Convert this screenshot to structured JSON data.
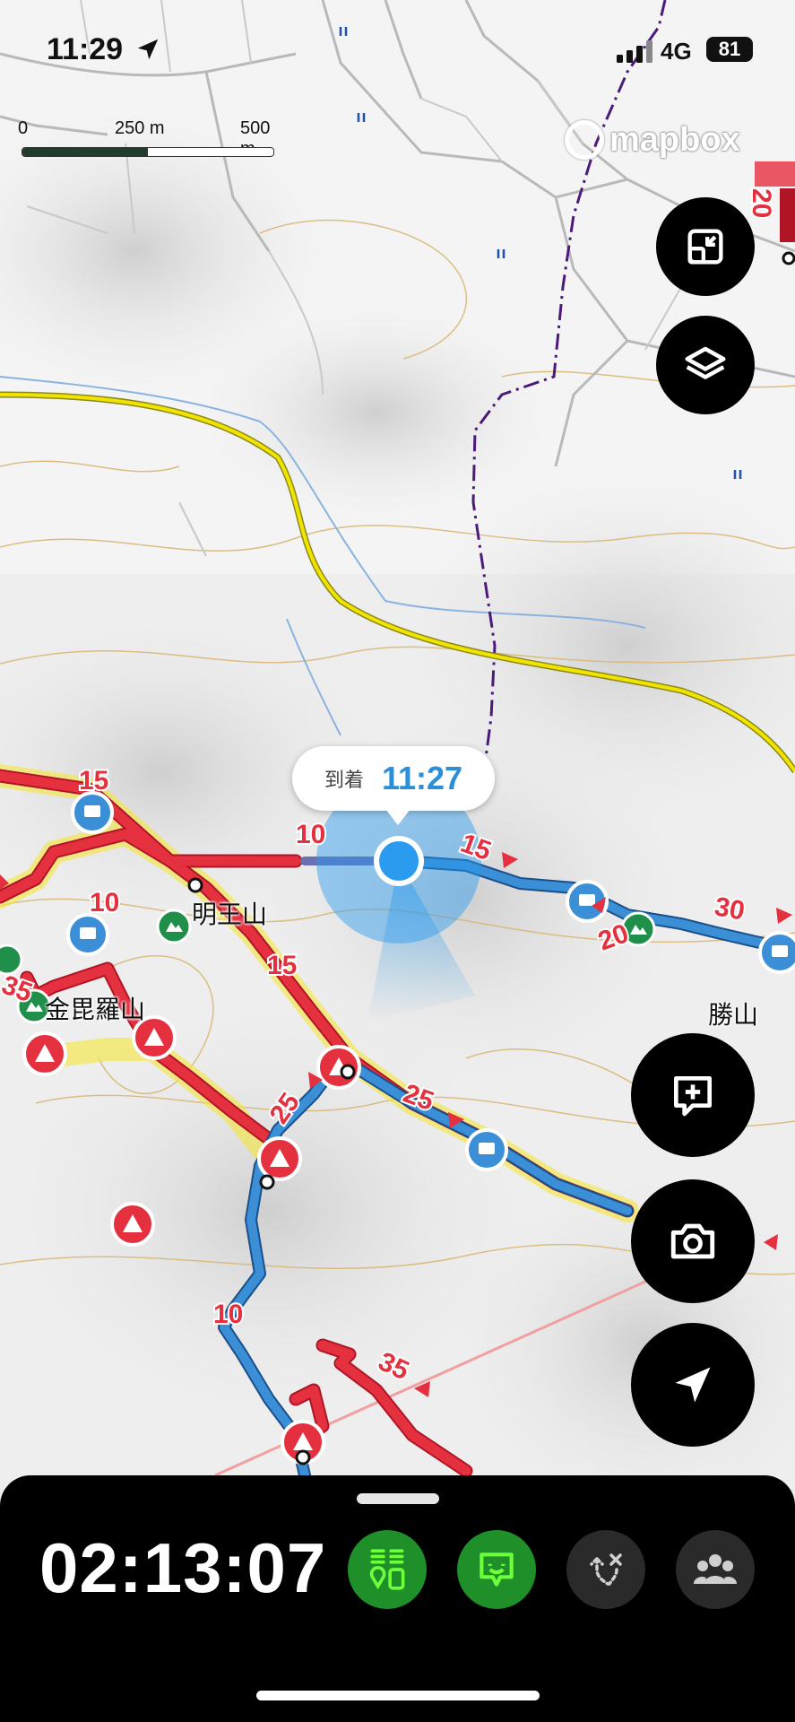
{
  "status_bar": {
    "time": "11:29",
    "network": "4G",
    "battery": "81"
  },
  "scale": {
    "labels": [
      "0",
      "250 m",
      "500 m"
    ]
  },
  "attribution": {
    "logo_text": "mapbox"
  },
  "callout": {
    "label": "到着",
    "value": "11:27"
  },
  "places": [
    {
      "name": "明王山",
      "key": "myoozan"
    },
    {
      "name": "金毘羅山",
      "key": "konpirasan"
    },
    {
      "name": "勝山",
      "key": "katsuyama"
    }
  ],
  "segment_labels": [
    "15",
    "10",
    "10",
    "15",
    "15",
    "20",
    "30",
    "25",
    "25",
    "10",
    "35",
    "35",
    "20"
  ],
  "timer": {
    "elapsed": "02:13:07"
  },
  "colors": {
    "accent_green": "#1f8f2a",
    "route_red": "#e5303f",
    "track_blue": "#3a8fd6",
    "boundary_purple": "#4b1a7a",
    "highway_yellow": "#f2e300",
    "location_blue": "#2b9bf0"
  },
  "icons": {
    "toolbar": [
      "trail-markers-icon",
      "chat-bubble-icon",
      "route-icon",
      "group-icon"
    ],
    "fabs": [
      "collapse-icon",
      "layers-icon",
      "add-comment-icon",
      "camera-icon",
      "navigation-arrow-icon"
    ]
  }
}
